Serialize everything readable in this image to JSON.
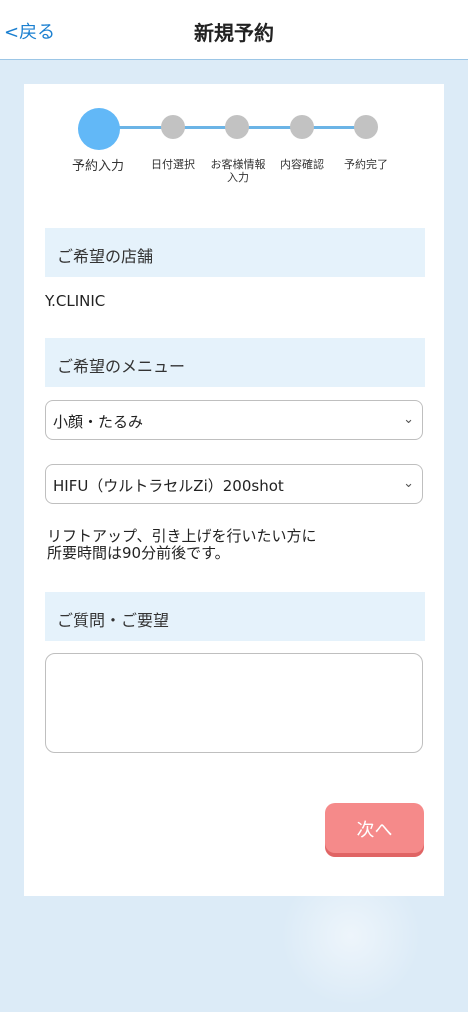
{
  "header": {
    "back_label": "<戻る",
    "title": "新規予約"
  },
  "steps": [
    {
      "label": "予約入力",
      "active": true
    },
    {
      "label": "日付選択",
      "active": false
    },
    {
      "label": "お客様情報\n入力",
      "active": false
    },
    {
      "label": "内容確認",
      "active": false
    },
    {
      "label": "予約完了",
      "active": false
    }
  ],
  "store_section": {
    "heading": "ご希望の店舗",
    "value": "Y.CLINIC"
  },
  "menu_section": {
    "heading": "ご希望のメニュー",
    "category_selected": "小顔・たるみ",
    "item_selected": "HIFU（ウルトラセルZi）200shot",
    "description_line1": "リフトアップ、引き上げを行いたい方に",
    "description_line2": "所要時間は90分前後です。"
  },
  "question_section": {
    "heading": "ご質問・ご要望",
    "value": ""
  },
  "next_button": {
    "label": "次へ"
  },
  "colors": {
    "accent_blue": "#62b8f7",
    "section_bg": "#e5f2fb",
    "next_button": "#f58a8a",
    "inactive_step": "#c2c2c2"
  }
}
